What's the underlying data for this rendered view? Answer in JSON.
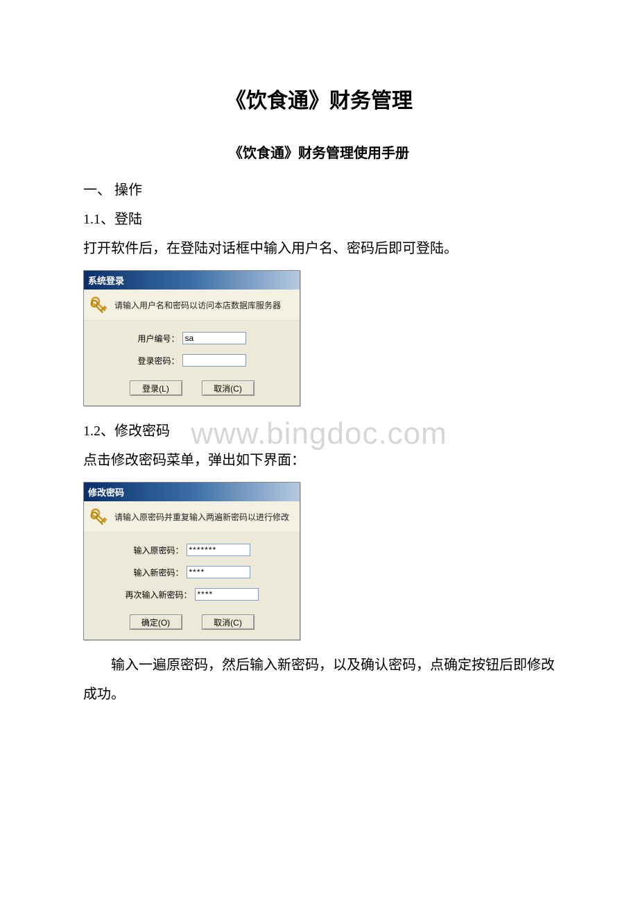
{
  "doc": {
    "title": "《饮食通》财务管理",
    "subtitle": "《饮食通》财务管理使用手册",
    "section1": "一、 操作",
    "section1_1": "1.1、登陆",
    "para1": "打开软件后，在登陆对话框中输入用户名、密码后即可登陆。",
    "section1_2": "1.2、修改密码",
    "para2": "点击修改密码菜单，弹出如下界面：",
    "para3": "输入一遍原密码，然后输入新密码，以及确认密码，点确定按钮后即修改成功。"
  },
  "watermark": "www.bingdoc.com",
  "login_dialog": {
    "title": "系统登录",
    "hint": "请输入用户名和密码以访问本店数据库服务器",
    "user_label": "用户编号：",
    "user_value": "sa",
    "pass_label": "登录密码：",
    "pass_value": "",
    "login_btn": "登录(L)",
    "cancel_btn": "取消(C)"
  },
  "password_dialog": {
    "title": "修改密码",
    "hint": "请输入原密码并重复输入两遍新密码以进行修改",
    "old_label": "输入原密码：",
    "old_value": "*******",
    "new_label": "输入新密码：",
    "new_value": "****",
    "confirm_label": "再次输入新密码：",
    "confirm_value": "****",
    "ok_btn": "确定(O)",
    "cancel_btn": "取消(C)"
  }
}
